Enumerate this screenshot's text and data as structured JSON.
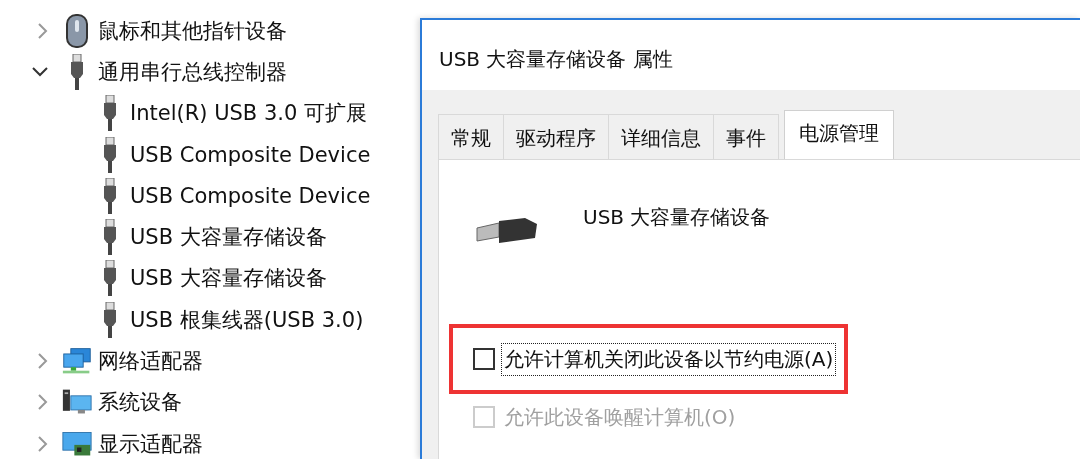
{
  "device_tree": [
    {
      "label": "鼠标和其他指针设备",
      "kind": "mouse",
      "expanded": false
    },
    {
      "label": "通用串行总线控制器",
      "kind": "usb",
      "expanded": true,
      "children": [
        {
          "label": "Intel(R) USB 3.0 可扩展",
          "kind": "usb"
        },
        {
          "label": "USB Composite Device",
          "kind": "usb"
        },
        {
          "label": "USB Composite Device",
          "kind": "usb"
        },
        {
          "label": "USB 大容量存储设备",
          "kind": "usb"
        },
        {
          "label": "USB 大容量存储设备",
          "kind": "usb"
        },
        {
          "label": "USB 根集线器(USB 3.0)",
          "kind": "usb"
        }
      ]
    },
    {
      "label": "网络适配器",
      "kind": "network",
      "expanded": false
    },
    {
      "label": "系统设备",
      "kind": "system",
      "expanded": false
    },
    {
      "label": "显示适配器",
      "kind": "display",
      "expanded": false
    }
  ],
  "dialog": {
    "title": "USB 大容量存储设备 属性",
    "tabs": [
      {
        "label": "常规",
        "selected": false
      },
      {
        "label": "驱动程序",
        "selected": false
      },
      {
        "label": "详细信息",
        "selected": false
      },
      {
        "label": "事件",
        "selected": false
      },
      {
        "label": "电源管理",
        "selected": true
      }
    ],
    "device_name": "USB 大容量存储设备",
    "options": [
      {
        "label": "允许计算机关闭此设备以节约电源(A)",
        "checked": false,
        "disabled": false,
        "focused": true,
        "highlighted": true
      },
      {
        "label": "允许此设备唤醒计算机(O)",
        "checked": false,
        "disabled": true,
        "focused": false,
        "highlighted": false
      }
    ]
  }
}
